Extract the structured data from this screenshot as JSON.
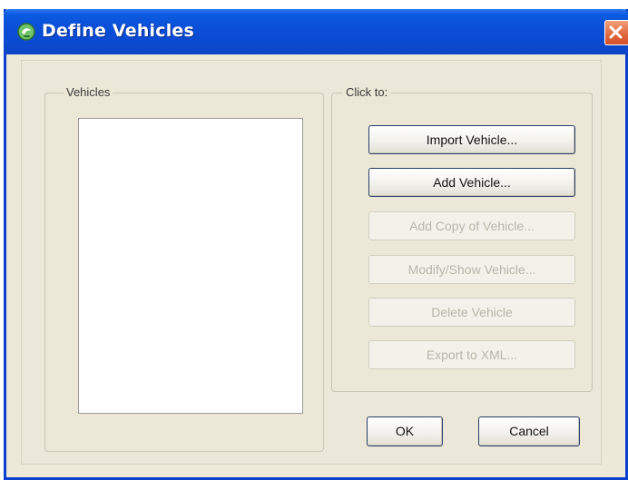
{
  "window": {
    "title": "Define Vehicles"
  },
  "vehicles_group": {
    "label": "Vehicles"
  },
  "clickto_group": {
    "label": "Click to:"
  },
  "buttons": {
    "import_vehicle": "Import Vehicle...",
    "add_vehicle": "Add Vehicle...",
    "add_copy_of_vehicle": "Add Copy of Vehicle...",
    "modify_show_vehicle": "Modify/Show Vehicle...",
    "delete_vehicle": "Delete Vehicle",
    "export_to_xml": "Export to XML...",
    "ok": "OK",
    "cancel": "Cancel"
  },
  "colors": {
    "titlebar": "#0a4fd8",
    "client_bg": "#ece9d8",
    "close_button": "#e0653b"
  },
  "icons": {
    "app_icon": "app-icon",
    "close_icon": "close-icon"
  }
}
